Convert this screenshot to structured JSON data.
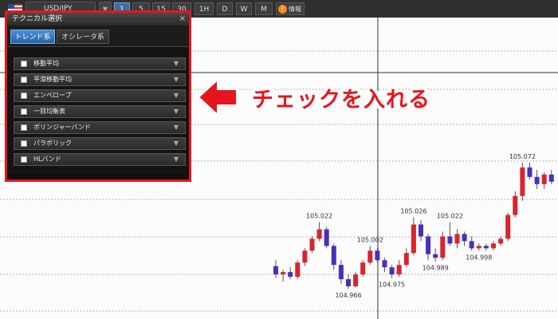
{
  "toolbar": {
    "symbol": "USD/JPY",
    "dropdown_icon": "chevron-down-icon",
    "timeframes": [
      "1",
      "5",
      "15",
      "30",
      "1H",
      "D",
      "W",
      "M"
    ],
    "active_timeframe": "1",
    "info_label": "情報"
  },
  "panel": {
    "title": "テクニカル選択",
    "close": "×",
    "tabs": [
      "トレンド系",
      "オシレータ系"
    ],
    "active_tab": "トレンド系",
    "items": [
      {
        "label": "移動平均",
        "checked": false
      },
      {
        "label": "平滑移動平均",
        "checked": false
      },
      {
        "label": "エンベロープ",
        "checked": false
      },
      {
        "label": "一目均衡表",
        "checked": false
      },
      {
        "label": "ボリンジャーバンド",
        "checked": false
      },
      {
        "label": "パラボリック",
        "checked": false
      },
      {
        "label": "HLバンド",
        "checked": false
      }
    ]
  },
  "callout": {
    "text": "チェックを入れる"
  },
  "chart_data": {
    "type": "candlestick",
    "price_labels": [
      "105.022",
      "105.002",
      "104.966",
      "105.026",
      "104.975",
      "105.022",
      "104.989",
      "104.998",
      "105.072"
    ],
    "candles": [
      {
        "o": 104.985,
        "h": 104.99,
        "l": 104.975,
        "c": 104.978
      },
      {
        "o": 104.978,
        "h": 104.982,
        "l": 104.972,
        "c": 104.98
      },
      {
        "o": 104.98,
        "h": 104.984,
        "l": 104.974,
        "c": 104.976
      },
      {
        "o": 104.976,
        "h": 104.99,
        "l": 104.974,
        "c": 104.988
      },
      {
        "o": 104.988,
        "h": 105.0,
        "l": 104.985,
        "c": 104.998
      },
      {
        "o": 104.998,
        "h": 105.01,
        "l": 104.996,
        "c": 105.008
      },
      {
        "o": 105.008,
        "h": 105.022,
        "l": 105.006,
        "c": 105.016
      },
      {
        "o": 105.016,
        "h": 105.018,
        "l": 105.0,
        "c": 105.002
      },
      {
        "o": 105.002,
        "h": 105.004,
        "l": 104.982,
        "c": 104.986
      },
      {
        "o": 104.986,
        "h": 104.99,
        "l": 104.97,
        "c": 104.974
      },
      {
        "o": 104.974,
        "h": 104.978,
        "l": 104.966,
        "c": 104.968
      },
      {
        "o": 104.968,
        "h": 104.98,
        "l": 104.967,
        "c": 104.978
      },
      {
        "o": 104.978,
        "h": 104.99,
        "l": 104.976,
        "c": 104.988
      },
      {
        "o": 104.988,
        "h": 105.002,
        "l": 104.986,
        "c": 104.998
      },
      {
        "o": 104.998,
        "h": 105.0,
        "l": 104.988,
        "c": 104.99
      },
      {
        "o": 104.99,
        "h": 104.992,
        "l": 104.98,
        "c": 104.984
      },
      {
        "o": 104.984,
        "h": 104.986,
        "l": 104.975,
        "c": 104.978
      },
      {
        "o": 104.978,
        "h": 104.99,
        "l": 104.976,
        "c": 104.986
      },
      {
        "o": 104.986,
        "h": 105.0,
        "l": 104.984,
        "c": 104.996
      },
      {
        "o": 104.996,
        "h": 105.026,
        "l": 104.994,
        "c": 105.02
      },
      {
        "o": 105.02,
        "h": 105.024,
        "l": 105.006,
        "c": 105.01
      },
      {
        "o": 105.01,
        "h": 105.012,
        "l": 104.99,
        "c": 104.995
      },
      {
        "o": 104.995,
        "h": 105.0,
        "l": 104.989,
        "c": 104.992
      },
      {
        "o": 104.992,
        "h": 105.014,
        "l": 104.99,
        "c": 105.01
      },
      {
        "o": 105.01,
        "h": 105.022,
        "l": 105.002,
        "c": 105.004
      },
      {
        "o": 105.004,
        "h": 105.016,
        "l": 105.0,
        "c": 105.012
      },
      {
        "o": 105.012,
        "h": 105.014,
        "l": 105.002,
        "c": 105.006
      },
      {
        "o": 105.006,
        "h": 105.01,
        "l": 104.998,
        "c": 105.0
      },
      {
        "o": 105.0,
        "h": 105.004,
        "l": 104.998,
        "c": 105.002
      },
      {
        "o": 105.002,
        "h": 105.004,
        "l": 104.998,
        "c": 105.0
      },
      {
        "o": 105.0,
        "h": 105.006,
        "l": 104.998,
        "c": 105.004
      },
      {
        "o": 105.004,
        "h": 105.01,
        "l": 105.002,
        "c": 105.008
      },
      {
        "o": 105.008,
        "h": 105.03,
        "l": 105.006,
        "c": 105.028
      },
      {
        "o": 105.028,
        "h": 105.048,
        "l": 105.026,
        "c": 105.044
      },
      {
        "o": 105.044,
        "h": 105.072,
        "l": 105.04,
        "c": 105.068
      },
      {
        "o": 105.068,
        "h": 105.072,
        "l": 105.058,
        "c": 105.06
      },
      {
        "o": 105.06,
        "h": 105.066,
        "l": 105.05,
        "c": 105.054
      },
      {
        "o": 105.054,
        "h": 105.064,
        "l": 105.05,
        "c": 105.062
      },
      {
        "o": 105.062,
        "h": 105.066,
        "l": 105.054,
        "c": 105.056
      }
    ],
    "colors": {
      "up": "#d8252b",
      "down": "#4a2fb8",
      "grid": "#b5b5b5",
      "crosshair": "#333333"
    }
  }
}
